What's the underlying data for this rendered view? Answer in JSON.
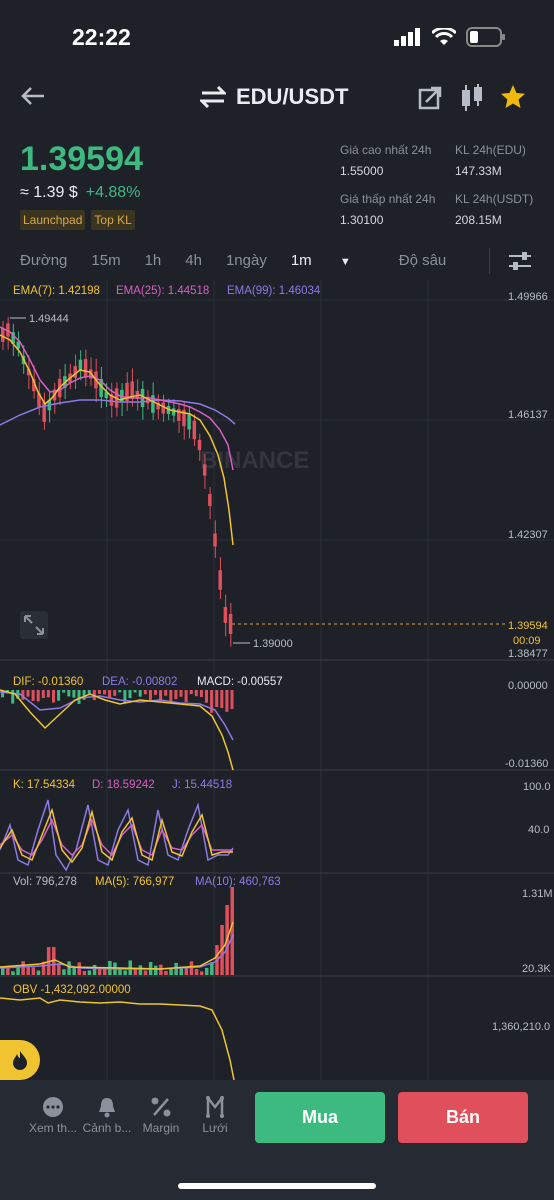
{
  "status_bar": {
    "time": "22:22"
  },
  "header": {
    "pair": "EDU/USDT"
  },
  "ticker": {
    "price": "1.39594",
    "fiat": "≈ 1.39 $",
    "change": "+4.88%",
    "tags": [
      "Launchpad",
      "Top KL"
    ],
    "stats": {
      "high_label": "Giá cao nhất 24h",
      "high_value": "1.55000",
      "low_label": "Giá thấp nhất 24h",
      "low_value": "1.30100",
      "vol_edu_label": "KL 24h(EDU)",
      "vol_edu_value": "147.33M",
      "vol_usdt_label": "KL 24h(USDT)",
      "vol_usdt_value": "208.15M"
    }
  },
  "timeframes": [
    "Đường",
    "15m",
    "1h",
    "4h",
    "1ngày",
    "1m",
    "Độ sâu"
  ],
  "active_timeframe": "1m",
  "chart": {
    "ema_labels": [
      "EMA(7): 1.42198",
      "EMA(25): 1.44518",
      "EMA(99): 1.46034"
    ],
    "price_axis": [
      "1.49966",
      "1.46137",
      "1.42307",
      "1.38477"
    ],
    "current_price_tag": "1.39594",
    "countdown": "00:09",
    "high_marker": "1.49444",
    "low_marker": "1.39000",
    "watermark": "BINANCE",
    "macd_labels": [
      "DIF: -0.01360",
      "DEA: -0.00802",
      "MACD: -0.00557"
    ],
    "macd_axis": [
      "0.00000",
      "-0.01360"
    ],
    "kdj_labels": [
      "K: 17.54334",
      "D: 18.59242",
      "J: 15.44518"
    ],
    "kdj_axis": [
      "100.0",
      "40.0"
    ],
    "vol_labels": [
      "Vol: 796,278",
      "MA(5): 766,977",
      "MA(10): 460,763"
    ],
    "vol_axis": [
      "1.31M",
      "20.3K"
    ],
    "obv_label": "OBV -1,432,092.00000",
    "obv_axis": "1,360,210.0"
  },
  "colors": {
    "up": "#3dba80",
    "down": "#e0505c",
    "ema7": "#f0c431",
    "ema25": "#d85fc4",
    "ema99": "#8c7ae6"
  },
  "bottom_nav": [
    {
      "icon": "chat-icon",
      "label": "Xem th..."
    },
    {
      "icon": "bell-icon",
      "label": "Cảnh b..."
    },
    {
      "icon": "percent-icon",
      "label": "Margin"
    },
    {
      "icon": "grid-icon",
      "label": "Lưới"
    }
  ],
  "buy_label": "Mua",
  "sell_label": "Bán"
}
